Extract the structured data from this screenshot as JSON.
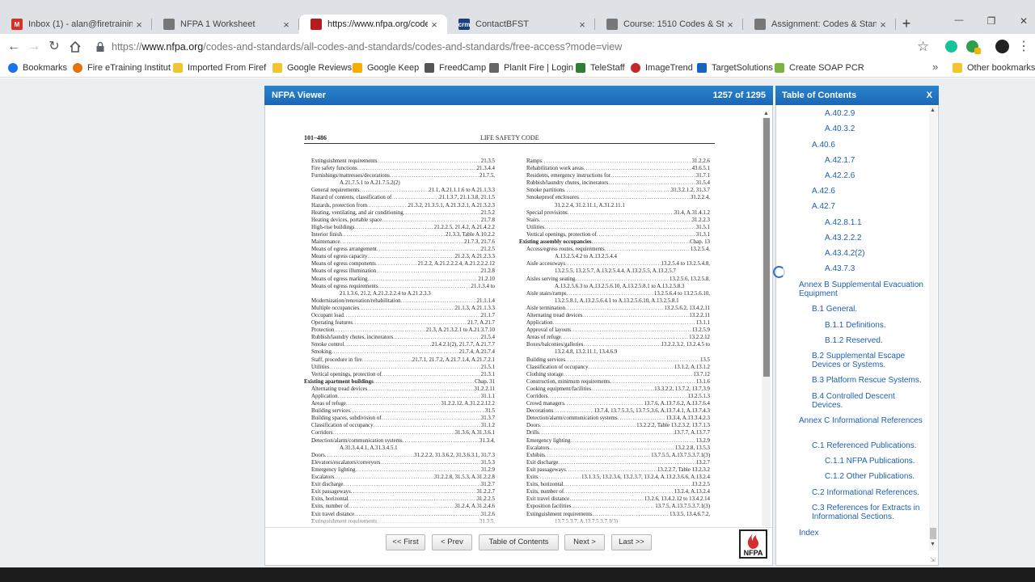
{
  "browser": {
    "tabs": [
      {
        "title": "Inbox (1) - alan@firetraining.c",
        "icon": "gmail-icon",
        "color": "#d93025",
        "glyph": "M"
      },
      {
        "title": "NFPA 1 Worksheet",
        "icon": "document-icon",
        "color": "#777777",
        "glyph": ""
      },
      {
        "title": "https://www.nfpa.org/codes-a",
        "icon": "nfpa-icon",
        "color": "#b71c1c",
        "glyph": ""
      },
      {
        "title": "ContactBFST",
        "icon": "crm-icon",
        "color": "#1a3f7a",
        "glyph": "crm"
      },
      {
        "title": "Course: 1510 Codes & Standa",
        "icon": "document-icon",
        "color": "#777777",
        "glyph": ""
      },
      {
        "title": "Assignment: Codes & Standard",
        "icon": "document-icon",
        "color": "#777777",
        "glyph": ""
      }
    ],
    "new_tab": "+",
    "tab_close": "×",
    "window_controls": {
      "minimize": "—",
      "restore": "❐",
      "close": "✕"
    },
    "url_scheme": "https://",
    "url_host": "www.nfpa.org",
    "url_path": "/codes-and-standards/all-codes-and-standards/codes-and-standards/free-access?mode=view",
    "star": "☆",
    "menu": "⋮",
    "bookmarks": [
      {
        "label": "Bookmarks",
        "icon": "star-icon"
      },
      {
        "label": "Fire eTraining Institut",
        "icon": "site-icon"
      },
      {
        "label": "Imported From Firef",
        "icon": "folder-icon"
      },
      {
        "label": "Google Reviews",
        "icon": "folder-icon"
      },
      {
        "label": "Google Keep",
        "icon": "keep-icon"
      },
      {
        "label": "FreedCamp",
        "icon": "freedcamp-icon"
      },
      {
        "label": "PlanIt Fire | Login",
        "icon": "planit-icon"
      },
      {
        "label": "TeleStaff",
        "icon": "telestaff-icon"
      },
      {
        "label": "ImageTrend",
        "icon": "imagetrend-icon"
      },
      {
        "label": "TargetSolutions",
        "icon": "targetsolutions-icon"
      },
      {
        "label": "Create SOAP PCR",
        "icon": "soap-icon"
      }
    ],
    "bookmarks_more": "»",
    "other_bookmarks": "Other bookmarks"
  },
  "viewer": {
    "title": "NFPA Viewer",
    "page_indicator": "1257 of 1295",
    "page_number": "101–486",
    "running_head": "LIFE SAFETY CODE",
    "nav": {
      "first": "<< First",
      "prev": "< Prev",
      "toc": "Table of Contents",
      "next": "Next >",
      "last": "Last >>"
    },
    "logo": "NFPA"
  },
  "index_left": [
    {
      "t": "Extinguishment requirements",
      "r": "21.3.5",
      "c": "l1"
    },
    {
      "t": "Fire safety functions",
      "r": "21.3.4.4",
      "c": "l1"
    },
    {
      "t": "Furnishings/mattresses/decorations",
      "r": "21.7.5,",
      "c": "l1"
    },
    {
      "t": "A.21.7.5.1 to A.21.7.5.2(2)",
      "r": "",
      "c": "cont"
    },
    {
      "t": "General requirements",
      "r": "21.1, A.21.1.1.6 to A.21.1.3.3",
      "c": "l1"
    },
    {
      "t": "Hazard of contents, classification of",
      "r": "21.1.3.7, 21.1.3.8, 21.1.5",
      "c": "l1"
    },
    {
      "t": "Hazards, protection from",
      "r": "21.3.2, 21.3.5.1, A.21.3.2.1, A.21.3.2.3",
      "c": "l1"
    },
    {
      "t": "Heating, ventilating, and air conditioning",
      "r": "21.5.2",
      "c": "l1"
    },
    {
      "t": "Heating devices, portable space",
      "r": "21.7.8",
      "c": "l1"
    },
    {
      "t": "High-rise buildings",
      "r": "21.2.2.5, 21.4.2, A.21.4.2.2",
      "c": "l1"
    },
    {
      "t": "Interior finish",
      "r": "21.3.3, Table A.10.2.2",
      "c": "l1"
    },
    {
      "t": "Maintenance",
      "r": "21.7.3, 21.7.6",
      "c": "l1"
    },
    {
      "t": "Means of egress arrangement",
      "r": "21.2.5",
      "c": "l1"
    },
    {
      "t": "Means of egress capacity",
      "r": "21.2.3, A.21.2.3.3",
      "c": "l1"
    },
    {
      "t": "Means of egress components",
      "r": "21.2.2, A.21.2.2.2.4, A.21.2.2.2.12",
      "c": "l1"
    },
    {
      "t": "Means of egress illumination",
      "r": "21.2.8",
      "c": "l1"
    },
    {
      "t": "Means of egress marking",
      "r": "21.2.10",
      "c": "l1"
    },
    {
      "t": "Means of egress requirements",
      "r": "21.1.3.4 to",
      "c": "l1"
    },
    {
      "t": "21.1.3.6, 21.2, A.21.2.2.2.4 to A.21.2.3.3",
      "r": "",
      "c": "cont"
    },
    {
      "t": "Modernization/renovation/rehabilitation",
      "r": "21.1.1.4",
      "c": "l1"
    },
    {
      "t": "Multiple occupancies",
      "r": "21.1.3, A.21.1.3.3",
      "c": "l1"
    },
    {
      "t": "Occupant load",
      "r": "21.1.7",
      "c": "l1"
    },
    {
      "t": "Operating features",
      "r": "21.7, A.21.7",
      "c": "l1"
    },
    {
      "t": "Protection",
      "r": "21.3, A.21.3.2.1 to A.21.3.7.10",
      "c": "l1"
    },
    {
      "t": "Rubbish/laundry chutes, incinerators",
      "r": "21.5.4",
      "c": "l1"
    },
    {
      "t": "Smoke control",
      "r": "21.4.2.1(2), 21.7.7, A.21.7.7",
      "c": "l1"
    },
    {
      "t": "Smoking",
      "r": "21.7.4, A.21.7.4",
      "c": "l1"
    },
    {
      "t": "Staff, procedure in fire",
      "r": "21.7.1, 21.7.2, A.21.7.1.4, A.21.7.2.1",
      "c": "l1"
    },
    {
      "t": "Utilities",
      "r": "21.5.1",
      "c": "l1"
    },
    {
      "t": "Vertical openings, protection of",
      "r": "21.3.1",
      "c": "l1"
    },
    {
      "t": "Existing apartment buildings",
      "r": "Chap. 31",
      "c": "hd"
    },
    {
      "t": "Alternating tread devices",
      "r": "31.2.2.11",
      "c": "l1"
    },
    {
      "t": "Application",
      "r": "31.1.1",
      "c": "l1"
    },
    {
      "t": "Areas of refuge",
      "r": "31.2.2.12, A.31.2.2.12.2",
      "c": "l1"
    },
    {
      "t": "Building services",
      "r": "31.5",
      "c": "l1"
    },
    {
      "t": "Building spaces, subdivision of",
      "r": "31.3.7",
      "c": "l1"
    },
    {
      "t": "Classification of occupancy",
      "r": "31.1.2",
      "c": "l1"
    },
    {
      "t": "Corridors",
      "r": "31.3.6, A.31.3.6.1",
      "c": "l1"
    },
    {
      "t": "Detection/alarm/communication systems",
      "r": "31.3.4,",
      "c": "l1"
    },
    {
      "t": "A.31.3.4.4.1, A.31.3.4.5.1",
      "r": "",
      "c": "cont"
    },
    {
      "t": "Doors",
      "r": "31.2.2.2, 31.3.6.2, 31.3.6.3.1, 31.7.3",
      "c": "l1"
    },
    {
      "t": "Elevators/escalators/conveyors",
      "r": "31.5.3",
      "c": "l1"
    },
    {
      "t": "Emergency lighting",
      "r": "31.2.9",
      "c": "l1"
    },
    {
      "t": "Escalators",
      "r": "31.2.2.8, 31.5.3, A.31.2.2.8",
      "c": "l1"
    },
    {
      "t": "Exit discharge",
      "r": "31.2.7",
      "c": "l1"
    },
    {
      "t": "Exit passageways",
      "r": "31.2.2.7",
      "c": "l1"
    },
    {
      "t": "Exits, horizontal",
      "r": "31.2.2.5",
      "c": "l1"
    },
    {
      "t": "Exits, number of",
      "r": "31.2.4, A.31.2.4.6",
      "c": "l1"
    },
    {
      "t": "Exit travel distance",
      "r": "31.2.6",
      "c": "l1"
    },
    {
      "t": "Extinguishment requirements",
      "r": "31.3.5,",
      "c": "l1"
    }
  ],
  "index_right": [
    {
      "t": "Ramps",
      "r": "31.2.2.6",
      "c": "l1"
    },
    {
      "t": "Rehabilitation work areas",
      "r": "43.6.5.1",
      "c": "l1"
    },
    {
      "t": "Residents, emergency instructions for",
      "r": "31.7.1",
      "c": "l1"
    },
    {
      "t": "Rubbish/laundry chutes, incinerators",
      "r": "31.5.4",
      "c": "l1"
    },
    {
      "t": "Smoke partitions",
      "r": "31.3.2.1.2, 31.3.7",
      "c": "l1"
    },
    {
      "t": "Smokeproof enclosures",
      "r": "31.2.2.4,",
      "c": "l1"
    },
    {
      "t": "31.2.2.4, 31.2.11.1, A.31.2.11.1",
      "r": "",
      "c": "cont"
    },
    {
      "t": "Special provisions",
      "r": "31.4, A.31.4.1.2",
      "c": "l1"
    },
    {
      "t": "Stairs",
      "r": "31.2.2.3",
      "c": "l1"
    },
    {
      "t": "Utilities",
      "r": "31.5.1",
      "c": "l1"
    },
    {
      "t": "Vertical openings, protection of",
      "r": "31.3.1",
      "c": "l1"
    },
    {
      "t": "Existing assembly occupancies",
      "r": "Chap. 13",
      "c": "hd"
    },
    {
      "t": "Access/egress routes, requirements",
      "r": "13.2.5.4,",
      "c": "l1"
    },
    {
      "t": "A.13.2.5.4.2 to A.13.2.5.4.4",
      "r": "",
      "c": "cont"
    },
    {
      "t": "Aisle accessways",
      "r": "13.2.5.4 to 13.2.5.4.8,",
      "c": "l1"
    },
    {
      "t": "13.2.5.5, 13.2.5.7, A.13.2.5.4.4, A.13.2.5.5, A.13.2.5.7",
      "r": "",
      "c": "cont"
    },
    {
      "t": "Aisles serving seating",
      "r": "13.2.5.6, 13.2.5.8,",
      "c": "l1"
    },
    {
      "t": "A.13.2.5.6.3 to A.13.2.5.6.10, A.13.2.5.8.1 to A.13.2.5.8.3",
      "r": "",
      "c": "cont"
    },
    {
      "t": "Aisle stairs/ramps",
      "r": "13.2.5.6.4 to 13.2.5.6.10,",
      "c": "l1"
    },
    {
      "t": "13.2.5.8.1, A.13.2.5.6.4.1 to A.13.2.5.6.10, A.13.2.5.8.1",
      "r": "",
      "c": "cont"
    },
    {
      "t": "Aisle termination",
      "r": "13.2.5.6.2, 13.4.2.11",
      "c": "l1"
    },
    {
      "t": "Alternating tread devices",
      "r": "13.2.2.11",
      "c": "l1"
    },
    {
      "t": "Application",
      "r": "13.1.1",
      "c": "l1"
    },
    {
      "t": "Approval of layouts",
      "r": "13.2.5.9",
      "c": "l1"
    },
    {
      "t": "Areas of refuge",
      "r": "13.2.2.12",
      "c": "l1"
    },
    {
      "t": "Boxes/balconies/galleries",
      "r": "13.2.2.3.2, 13.2.4.5 to",
      "c": "l1"
    },
    {
      "t": "13.2.4.8, 13.2.11.1, 13.4.6.9",
      "r": "",
      "c": "cont"
    },
    {
      "t": "Building services",
      "r": "13.5",
      "c": "l1"
    },
    {
      "t": "Classification of occupancy",
      "r": "13.1.2, A.13.1.2",
      "c": "l1"
    },
    {
      "t": "Clothing storage",
      "r": "13.7.12",
      "c": "l1"
    },
    {
      "t": "Construction, minimum requirements",
      "r": "13.1.6",
      "c": "l1"
    },
    {
      "t": "Cooking equipment/facilities",
      "r": "13.3.2.2, 13.7.2, 13.7.3.9",
      "c": "l1"
    },
    {
      "t": "Corridors",
      "r": "13.2.5.1.3",
      "c": "l1"
    },
    {
      "t": "Crowd managers",
      "r": "13.7.6, A.13.7.6.2, A.13.7.6.4",
      "c": "l1"
    },
    {
      "t": "Decorations",
      "r": "13.7.4, 13.7.5.3.5, 13.7.5.3.6, A.13.7.4.1, A.13.7.4.3",
      "c": "l1"
    },
    {
      "t": "Detection/alarm/communication systems",
      "r": "13.3.4, A.13.3.4.2.3",
      "c": "l1"
    },
    {
      "t": "Doors",
      "r": "13.2.2.2, Table 13.2.3.2, 13.7.1.3",
      "c": "l1"
    },
    {
      "t": "Drills",
      "r": "13.7.7, A.13.7.7",
      "c": "l1"
    },
    {
      "t": "Emergency lighting",
      "r": "13.2.9",
      "c": "l1"
    },
    {
      "t": "Escalators",
      "r": "13.2.2.8, 13.5.3",
      "c": "l1"
    },
    {
      "t": "Exhibits",
      "r": "13.7.5.5, A.13.7.5.3.7.1(3)",
      "c": "l1"
    },
    {
      "t": "Exit discharge",
      "r": "13.2.7",
      "c": "l1"
    },
    {
      "t": "Exit passageways",
      "r": "13.2.2.7, Table 13.2.3.2",
      "c": "l1"
    },
    {
      "t": "Exits",
      "r": "13.1.3.5, 13.2.3.6, 13.2.3.7, 13.2.4, A.13.2.3.6.6, A.13.2.4",
      "c": "l1"
    },
    {
      "t": "Exits, horizontal",
      "r": "13.2.2.5",
      "c": "l1"
    },
    {
      "t": "Exits, number of",
      "r": "13.2.4, A.13.2.4",
      "c": "l1"
    },
    {
      "t": "Exit travel distance",
      "r": "13.2.6, 13.4.2.12 to 13.4.2.14",
      "c": "l1"
    },
    {
      "t": "Exposition facilities",
      "r": "13.7.5, A.13.7.5.3.7.1(3)",
      "c": "l1"
    },
    {
      "t": "Extinguishment requirements",
      "r": "13.3.5, 13.4.6.7.2,",
      "c": "l1"
    },
    {
      "t": "13.7.5.3.7, A.13.7.5.3.7.1(3)",
      "r": "",
      "c": "cont"
    }
  ],
  "toc": {
    "title": "Table of Contents",
    "close": "X",
    "items": [
      {
        "label": "A.40.2.9",
        "level": 3
      },
      {
        "label": "A.40.3.2",
        "level": 3
      },
      {
        "label": "A.40.6",
        "level": 2
      },
      {
        "label": "A.42.1.7",
        "level": 3
      },
      {
        "label": "A.42.2.6",
        "level": 3
      },
      {
        "label": "A.42.6",
        "level": 2
      },
      {
        "label": "A.42.7",
        "level": 2
      },
      {
        "label": "A.42.8.1.1",
        "level": 3
      },
      {
        "label": "A.43.2.2.2",
        "level": 3
      },
      {
        "label": "A.43.4.2(2)",
        "level": 3
      },
      {
        "label": "A.43.7.3",
        "level": 3
      },
      {
        "label": "Annex B Supplemental Evacuation Equipment",
        "level": 1
      },
      {
        "label": "B.1 General.",
        "level": 2
      },
      {
        "label": "B.1.1 Definitions.",
        "level": 3
      },
      {
        "label": "B.1.2 Reserved.",
        "level": 3
      },
      {
        "label": "B.2 Supplemental Escape Devices or Systems.",
        "level": 2
      },
      {
        "label": "B.3 Platform Rescue Systems.",
        "level": 2
      },
      {
        "label": "B.4 Controlled Descent Devices.",
        "level": 2
      },
      {
        "label": "Annex C Informational References",
        "level": 1
      },
      {
        "label": "C.1 Referenced Publications.",
        "level": 2
      },
      {
        "label": "C.1.1 NFPA Publications.",
        "level": 3
      },
      {
        "label": "C.1.2 Other Publications.",
        "level": 3
      },
      {
        "label": "C.2 Informational References.",
        "level": 2
      },
      {
        "label": "C.3 References for Extracts in Informational Sections.",
        "level": 2
      },
      {
        "label": "Index",
        "level": 1
      }
    ]
  },
  "colors": {
    "header_blue": "#1f72c2",
    "link_blue": "#1f5fb3",
    "page_bg": "#eceff1",
    "nfpa_red": "#d32f2f"
  }
}
